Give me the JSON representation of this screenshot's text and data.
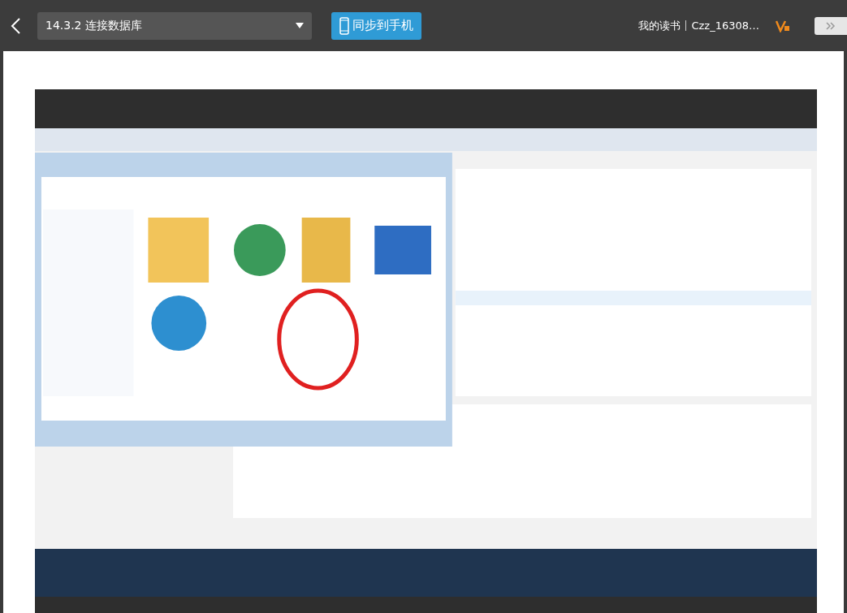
{
  "header": {
    "chapter": "14.3.2 连接数据库",
    "sync_button": "同步到手机",
    "my_reading": "我的读书",
    "user": "Czz_16308…"
  }
}
